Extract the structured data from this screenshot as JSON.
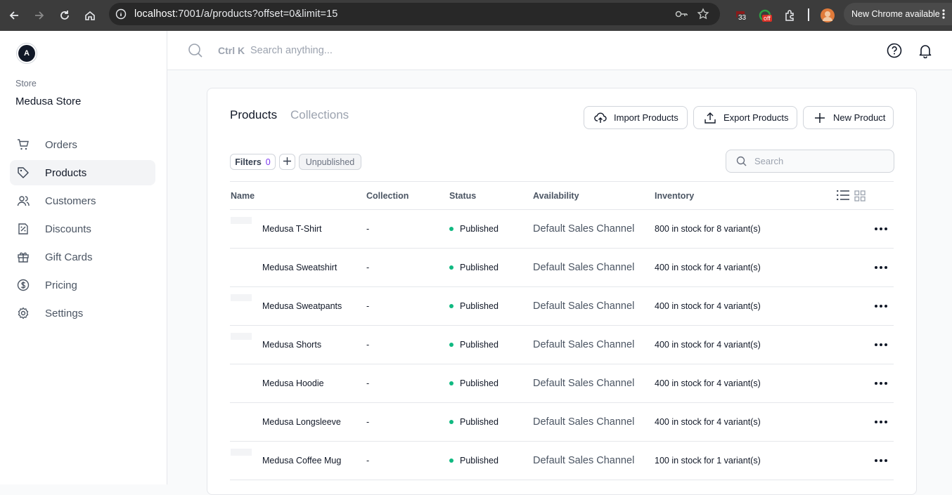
{
  "browser": {
    "url_host": "localhost",
    "url_rest": ":7001/a/products?offset=0&limit=15",
    "ext_badge_1": "33",
    "ext_badge_2": "off",
    "new_chrome": "New Chrome available"
  },
  "sidebar": {
    "avatar_letter": "A",
    "store_label": "Store",
    "store_name": "Medusa Store",
    "items": [
      {
        "label": "Orders",
        "icon": "cart-icon"
      },
      {
        "label": "Products",
        "icon": "tag-icon",
        "active": true
      },
      {
        "label": "Customers",
        "icon": "users-icon"
      },
      {
        "label": "Discounts",
        "icon": "discount-icon"
      },
      {
        "label": "Gift Cards",
        "icon": "gift-icon"
      },
      {
        "label": "Pricing",
        "icon": "dollar-icon"
      },
      {
        "label": "Settings",
        "icon": "gear-icon"
      }
    ]
  },
  "topbar": {
    "shortcut": "Ctrl K",
    "search_placeholder": "Search anything..."
  },
  "main": {
    "tabs": [
      "Products",
      "Collections"
    ],
    "buttons": {
      "import": "Import Products",
      "export": "Export Products",
      "new": "New Product"
    },
    "filters_label": "Filters",
    "filters_count": "0",
    "filter_chip": "Unpublished",
    "search_placeholder": "Search",
    "columns": [
      "Name",
      "Collection",
      "Status",
      "Availability",
      "Inventory"
    ],
    "rows": [
      {
        "name": "Medusa T-Shirt",
        "collection": "-",
        "status": "Published",
        "availability": "Default Sales Channel",
        "inventory": "800 in stock for 8 variant(s)"
      },
      {
        "name": "Medusa Sweatshirt",
        "collection": "-",
        "status": "Published",
        "availability": "Default Sales Channel",
        "inventory": "400 in stock for 4 variant(s)"
      },
      {
        "name": "Medusa Sweatpants",
        "collection": "-",
        "status": "Published",
        "availability": "Default Sales Channel",
        "inventory": "400 in stock for 4 variant(s)"
      },
      {
        "name": "Medusa Shorts",
        "collection": "-",
        "status": "Published",
        "availability": "Default Sales Channel",
        "inventory": "400 in stock for 4 variant(s)"
      },
      {
        "name": "Medusa Hoodie",
        "collection": "-",
        "status": "Published",
        "availability": "Default Sales Channel",
        "inventory": "400 in stock for 4 variant(s)"
      },
      {
        "name": "Medusa Longsleeve",
        "collection": "-",
        "status": "Published",
        "availability": "Default Sales Channel",
        "inventory": "400 in stock for 4 variant(s)"
      },
      {
        "name": "Medusa Coffee Mug",
        "collection": "-",
        "status": "Published",
        "availability": "Default Sales Channel",
        "inventory": "100 in stock for 1 variant(s)"
      }
    ]
  },
  "colors": {
    "accent": "#7c3aed",
    "published": "#10b981"
  }
}
